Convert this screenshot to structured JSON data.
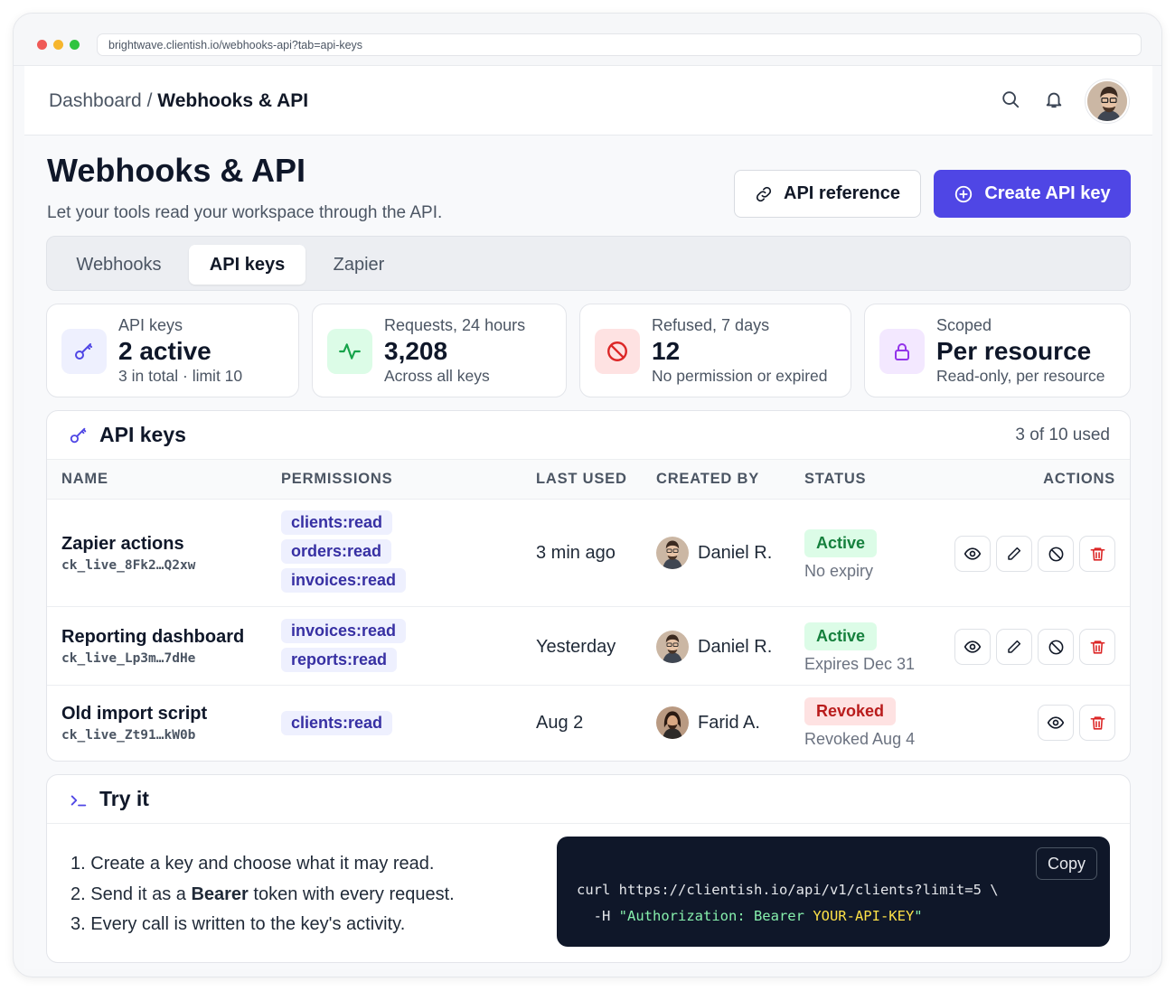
{
  "browser": {
    "url": "brightwave.clientish.io/webhooks-api?tab=api-keys"
  },
  "breadcrumb": {
    "root": "Dashboard",
    "separator": " / ",
    "current": "Webhooks & API"
  },
  "header": {
    "title": "Webhooks & API",
    "subtitle": "Let your tools read your workspace through the API.",
    "api_reference_label": "API reference",
    "create_label": "Create API key"
  },
  "tabs": [
    {
      "label": "Webhooks"
    },
    {
      "label": "API keys"
    },
    {
      "label": "Zapier"
    }
  ],
  "stats": [
    {
      "label": "API keys",
      "value": "2 active",
      "sub": "3 in total · limit 10",
      "icon": "key-icon"
    },
    {
      "label": "Requests, 24 hours",
      "value": "3,208",
      "sub": "Across all keys",
      "icon": "activity-icon"
    },
    {
      "label": "Refused, 7 days",
      "value": "12",
      "sub": "No permission or expired",
      "icon": "ban-icon"
    },
    {
      "label": "Scoped",
      "value": "Per resource",
      "sub": "Read-only, per resource",
      "icon": "lock-icon"
    }
  ],
  "keys_card": {
    "title": "API keys",
    "usage": "3 of 10 used",
    "columns": [
      "NAME",
      "PERMISSIONS",
      "LAST USED",
      "CREATED BY",
      "STATUS",
      "ACTIONS"
    ],
    "rows": [
      {
        "name": "Zapier actions",
        "key_id": "ck_live_8Fk2…Q2xw",
        "permissions": [
          "clients:read",
          "orders:read",
          "invoices:read"
        ],
        "last_used": "3 min ago",
        "created_by": "Daniel R.",
        "status": "Active",
        "status_detail": "No expiry"
      },
      {
        "name": "Reporting dashboard",
        "key_id": "ck_live_Lp3m…7dHe",
        "permissions": [
          "invoices:read",
          "reports:read"
        ],
        "last_used": "Yesterday",
        "created_by": "Daniel R.",
        "status": "Active",
        "status_detail": "Expires Dec 31"
      },
      {
        "name": "Old import script",
        "key_id": "ck_live_Zt91…kW0b",
        "permissions": [
          "clients:read"
        ],
        "last_used": "Aug 2",
        "created_by": "Farid A.",
        "status": "Revoked",
        "status_detail": "Revoked Aug 4"
      }
    ]
  },
  "try_card": {
    "title": "Try it",
    "steps": {
      "s1": "Create a key and choose what it may read.",
      "s2_before": "Send it as a ",
      "s2_bold": "Bearer",
      "s2_after": " token with every request.",
      "s3": "Every call is written to the key's activity."
    },
    "code": {
      "copy_label": "Copy",
      "line1": "curl https://clientish.io/api/v1/clients?limit=5 \\",
      "line2_flag": "  -H ",
      "line2_string": "\"Authorization: Bearer ",
      "line2_token": "YOUR-API-KEY",
      "line2_end": "\""
    }
  },
  "colors": {
    "accent": "#4f46e5",
    "active": "#15803d",
    "revoked": "#b91c1c",
    "code_bg": "#0f1729"
  }
}
